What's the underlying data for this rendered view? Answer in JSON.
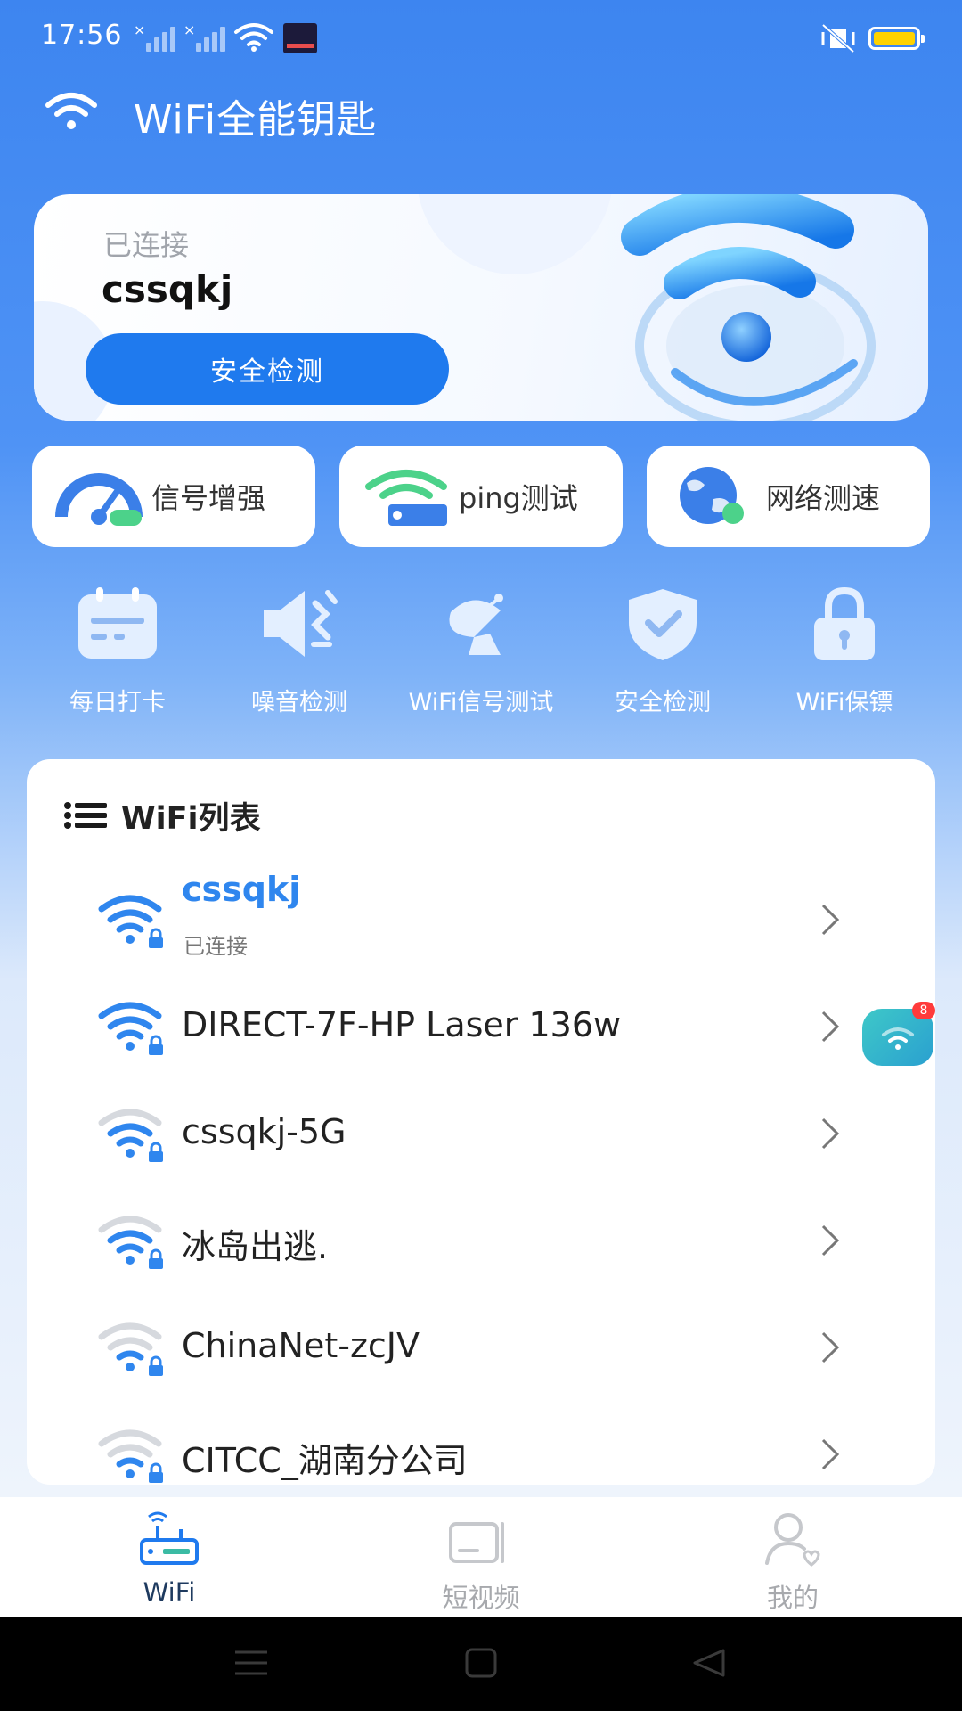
{
  "status_bar": {
    "time": "17:56"
  },
  "header": {
    "title": "WiFi全能钥匙"
  },
  "hero": {
    "status": "已连接",
    "ssid": "cssqkj",
    "scan_button": "安全检测"
  },
  "quick_tools": [
    {
      "label": "信号增强",
      "icon": "speedometer-icon"
    },
    {
      "label": "ping测试",
      "icon": "router-wifi-icon"
    },
    {
      "label": "网络测速",
      "icon": "globe-icon"
    }
  ],
  "features": [
    {
      "label": "每日打卡",
      "icon": "calendar-icon"
    },
    {
      "label": "噪音检测",
      "icon": "speaker-icon"
    },
    {
      "label": "WiFi信号测试",
      "icon": "satellite-dish-icon"
    },
    {
      "label": "安全检测",
      "icon": "shield-check-icon"
    },
    {
      "label": "WiFi保镖",
      "icon": "lock-icon"
    }
  ],
  "wifi_list": {
    "title": "WiFi列表",
    "networks": [
      {
        "ssid": "cssqkj",
        "status": "已连接",
        "strength": 4
      },
      {
        "ssid": "DIRECT-7F-HP Laser 136w",
        "strength": 4
      },
      {
        "ssid": "cssqkj-5G",
        "strength": 3
      },
      {
        "ssid": "冰岛出逃.",
        "strength": 3
      },
      {
        "ssid": "ChinaNet-zcJV",
        "strength": 2
      },
      {
        "ssid": "CITCC_湖南分公司",
        "strength": 2
      }
    ]
  },
  "floating_badge": {
    "count": "8"
  },
  "bottom_nav": [
    {
      "label": "WiFi",
      "icon": "router-icon",
      "active": true
    },
    {
      "label": "短视频",
      "icon": "video-icon",
      "active": false
    },
    {
      "label": "我的",
      "icon": "user-icon",
      "active": false
    }
  ],
  "colors": {
    "primary": "#1f7aee",
    "connected": "#2f86ee",
    "background_top": "#3d85f0"
  }
}
